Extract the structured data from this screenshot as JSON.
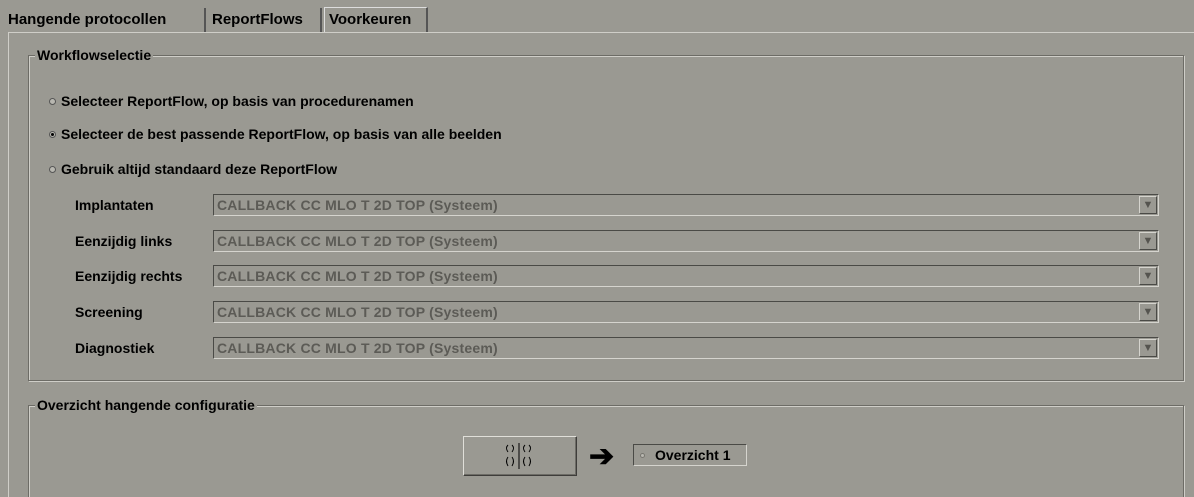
{
  "tabs": [
    {
      "label": "Hangende protocollen"
    },
    {
      "label": "ReportFlows"
    },
    {
      "label": "Voorkeuren"
    }
  ],
  "workflow": {
    "legend": "Workflowselectie",
    "options": [
      {
        "label": "Selecteer ReportFlow, op basis van procedurenamen",
        "selected": false
      },
      {
        "label": "Selecteer de best passende ReportFlow, op basis van alle beelden",
        "selected": true
      },
      {
        "label": "Gebruik altijd standaard deze ReportFlow",
        "selected": false
      }
    ],
    "fields": [
      {
        "label": "Implantaten",
        "value": "CALLBACK CC MLO T 2D TOP (Systeem)"
      },
      {
        "label": "Eenzijdig links",
        "value": "CALLBACK CC MLO T 2D TOP (Systeem)"
      },
      {
        "label": "Eenzijdig rechts",
        "value": "CALLBACK CC MLO T 2D TOP (Systeem)"
      },
      {
        "label": "Screening",
        "value": "CALLBACK CC MLO T 2D TOP (Systeem)"
      },
      {
        "label": "Diagnostiek",
        "value": "CALLBACK CC MLO T 2D TOP (Systeem)"
      }
    ],
    "dropdown_icon": "triangle-down"
  },
  "hanging": {
    "legend": "Overzicht hangende configuratie",
    "layout_button_icon": "four-view-layout-icon",
    "arrow_icon": "right-arrow",
    "overview_label": "Overzicht 1"
  }
}
